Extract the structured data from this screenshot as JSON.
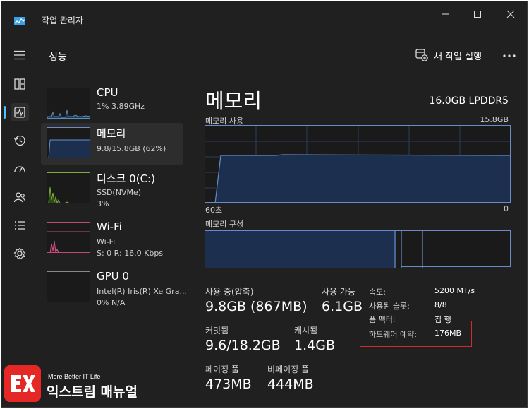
{
  "window": {
    "title": "작업 관리자"
  },
  "header": {
    "page_title": "성능",
    "run_task_label": "새 작업 실행"
  },
  "nav": {
    "items": [
      "processes",
      "performance",
      "app-history",
      "startup-apps",
      "users",
      "details",
      "services"
    ],
    "active": "performance"
  },
  "perf_list": [
    {
      "name": "CPU",
      "sub1": "1% 3.89GHz",
      "sub2": ""
    },
    {
      "name": "메모리",
      "sub1": "9.8/15.8GB (62%)",
      "sub2": ""
    },
    {
      "name": "디스크 0(C:)",
      "sub1": "SSD(NVMe)",
      "sub2": "3%"
    },
    {
      "name": "Wi-Fi",
      "sub1": "Wi-Fi",
      "sub2": "S: 0  R: 16.0 Kbps"
    },
    {
      "name": "GPU 0",
      "sub1": "Intel(R) Iris(R) Xe Gra...",
      "sub2": "0% N/A"
    }
  ],
  "detail": {
    "title": "메모리",
    "spec": "16.0GB LPDDR5",
    "usage_label": "메모리 사용",
    "usage_max": "15.8GB",
    "time_left": "60초",
    "time_right": "0",
    "composition_label": "메모리 구성",
    "stats": {
      "in_use_label": "사용 중(압축)",
      "in_use_value": "9.8GB (867MB)",
      "available_label": "사용 가능",
      "available_value": "6.1GB",
      "committed_label": "커밋됨",
      "committed_value": "9.6/18.2GB",
      "cached_label": "캐시됨",
      "cached_value": "1.4GB",
      "paged_label": "페이징 풀",
      "paged_value": "473MB",
      "nonpaged_label": "비페이징 풀",
      "nonpaged_value": "444MB"
    },
    "props": {
      "speed_label": "속도:",
      "speed_value": "5200 MT/s",
      "slots_label": "사용된 슬롯:",
      "slots_value": "8/8",
      "form_label": "폼 팩터:",
      "form_value": "칩 행",
      "reserved_label": "하드웨어 예약:",
      "reserved_value": "176MB"
    }
  },
  "watermark": {
    "small": "More Better IT Life",
    "big": "익스트림 매뉴얼"
  },
  "colors": {
    "accent": "#4cc2ff",
    "mem_fill": "#1c2f4f",
    "mem_line": "#6a8bc8",
    "highlight": "#d22a2a",
    "brand_red": "#e52726"
  }
}
